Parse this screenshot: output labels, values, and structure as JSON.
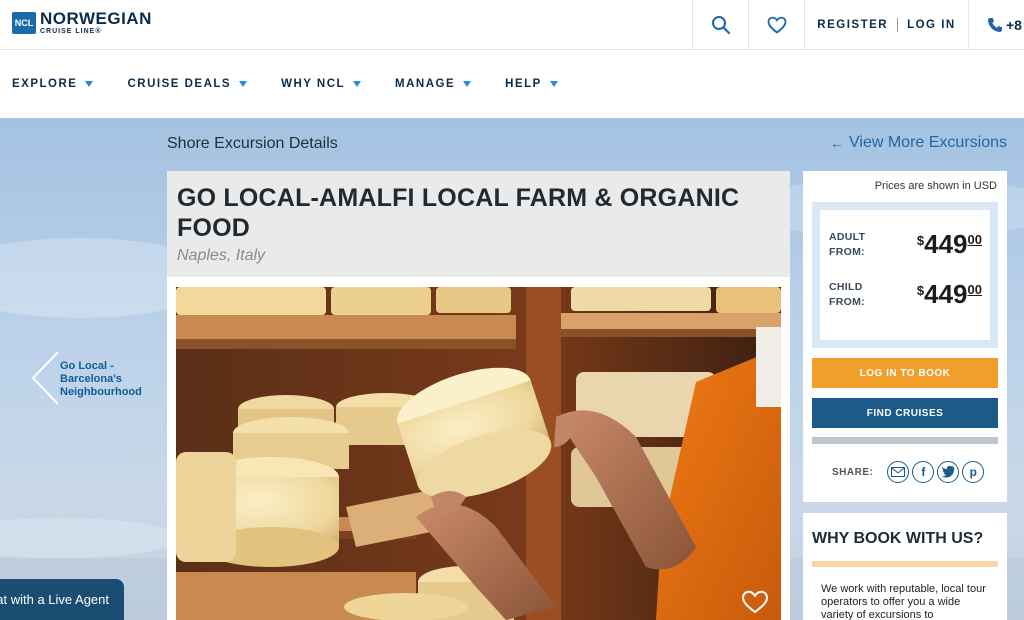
{
  "brand": {
    "badge": "NCL",
    "name": "NORWEGIAN",
    "tagline": "CRUISE LINE®"
  },
  "topbar": {
    "register_label": "REGISTER",
    "login_label": "LOG IN",
    "phone_prefix": "+8"
  },
  "nav": [
    {
      "label": "EXPLORE"
    },
    {
      "label": "CRUISE DEALS"
    },
    {
      "label": "WHY NCL"
    },
    {
      "label": "MANAGE"
    },
    {
      "label": "HELP"
    }
  ],
  "page": {
    "heading": "Shore Excursion Details",
    "view_more": "View More Excursions",
    "prev": {
      "line1": "Go Local -",
      "line2": "Barcelona's",
      "line3": "Neighbourhood"
    }
  },
  "excursion": {
    "title": "GO LOCAL-AMALFI LOCAL FARM & ORGANIC FOOD",
    "location": "Naples, Italy"
  },
  "pricing": {
    "note": "Prices are shown in USD",
    "adult": {
      "label1": "ADULT",
      "label2": "FROM:",
      "currency": "$",
      "amount": "449",
      "cents": "00"
    },
    "child": {
      "label1": "CHILD",
      "label2": "FROM:",
      "currency": "$",
      "amount": "449",
      "cents": "00"
    },
    "login_button": "LOG IN TO BOOK",
    "find_button": "FIND CRUISES",
    "share_label": "SHARE:"
  },
  "why": {
    "title": "WHY BOOK WITH US?",
    "text": "We work with reputable, local tour operators to offer you a wide variety of excursions to"
  },
  "chat": {
    "label": "Chat with a Live Agent"
  },
  "colors": {
    "accent": "#1e66a8",
    "orange": "#f29e2b",
    "navy": "#1c5b87"
  }
}
